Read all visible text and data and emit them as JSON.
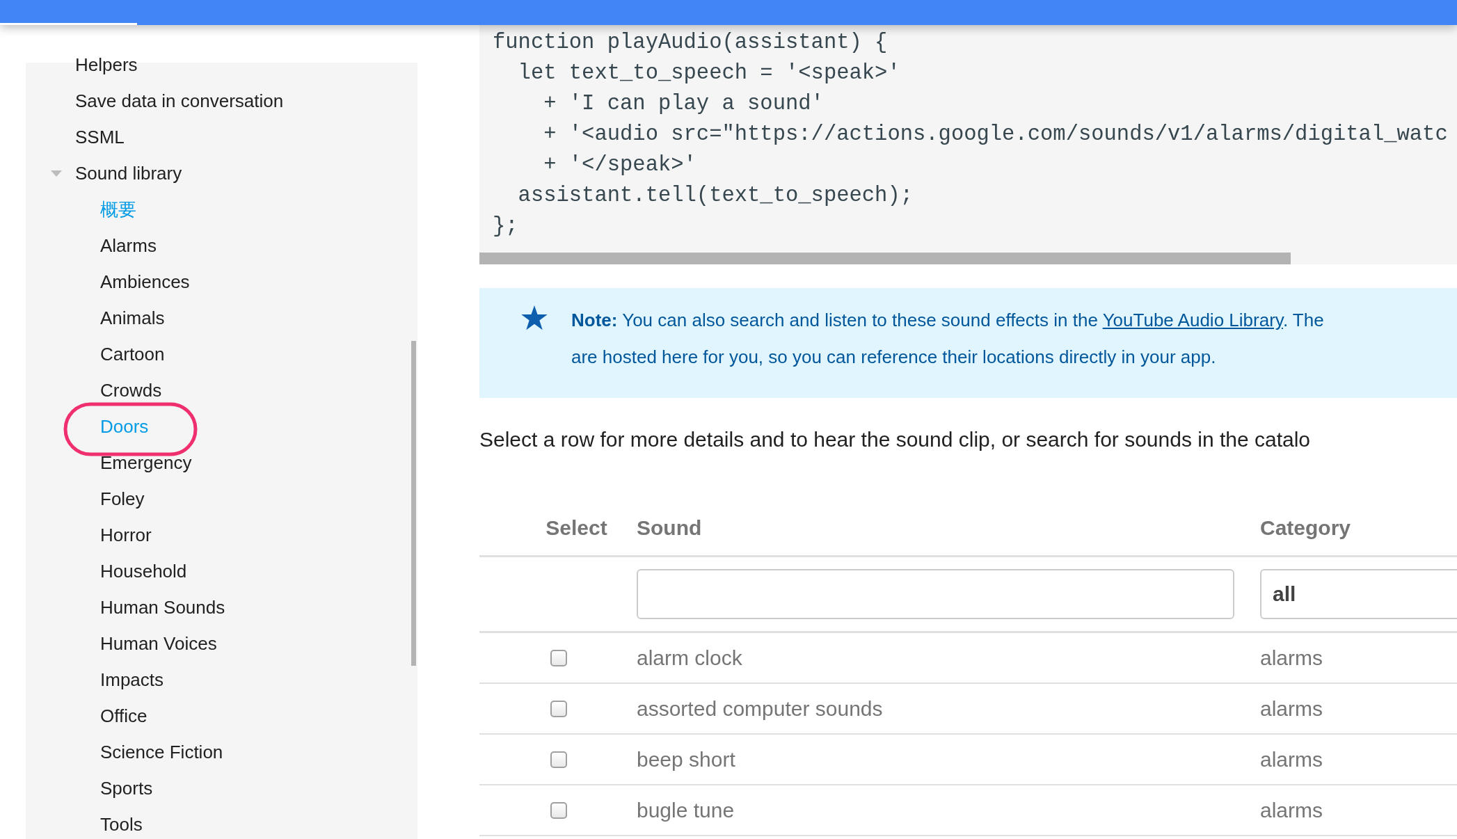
{
  "top_bar": {
    "tab_indicator": true
  },
  "sidebar": {
    "items": [
      {
        "label": "Helpers",
        "selected": false
      },
      {
        "label": "Save data in conversation",
        "selected": false
      },
      {
        "label": "SSML",
        "selected": false
      },
      {
        "label": "Sound library",
        "selected": false,
        "expanded": true,
        "children": [
          {
            "label": "概要",
            "selected": true
          },
          {
            "label": "Alarms",
            "selected": false
          },
          {
            "label": "Ambiences",
            "selected": false
          },
          {
            "label": "Animals",
            "selected": false
          },
          {
            "label": "Cartoon",
            "selected": false
          },
          {
            "label": "Crowds",
            "selected": false
          },
          {
            "label": "Doors",
            "selected": true
          },
          {
            "label": "Emergency",
            "selected": false
          },
          {
            "label": "Foley",
            "selected": false
          },
          {
            "label": "Horror",
            "selected": false
          },
          {
            "label": "Household",
            "selected": false
          },
          {
            "label": "Human Sounds",
            "selected": false
          },
          {
            "label": "Human Voices",
            "selected": false
          },
          {
            "label": "Impacts",
            "selected": false
          },
          {
            "label": "Office",
            "selected": false
          },
          {
            "label": "Science Fiction",
            "selected": false
          },
          {
            "label": "Sports",
            "selected": false
          },
          {
            "label": "Tools",
            "selected": false
          }
        ]
      }
    ]
  },
  "code": [
    "function playAudio(assistant) {",
    "  let text_to_speech = '<speak>'",
    "    + 'I can play a sound'",
    "    + '<audio src=\"https://actions.google.com/sounds/v1/alarms/digital_watc",
    "    + '</speak>'",
    "  assistant.tell(text_to_speech);",
    "};"
  ],
  "note": {
    "label": "Note:",
    "text": "You can also search and listen to these sound effects in the",
    "link": "YouTube Audio Library",
    "text_after": ". The",
    "line_2": "are hosted here for you, so you can reference their locations directly in your app."
  },
  "intro": "Select a row for more details and to hear the sound clip, or search for sounds in the catalo",
  "table": {
    "columns": [
      "Select",
      "Sound",
      "Category"
    ],
    "filters": {
      "category": "all"
    },
    "rows": [
      {
        "checked": false,
        "sound": "alarm clock",
        "category": "alarms"
      },
      {
        "checked": false,
        "sound": "assorted computer sounds",
        "category": "alarms"
      },
      {
        "checked": false,
        "sound": "beep short",
        "category": "alarms"
      },
      {
        "checked": false,
        "sound": "bugle tune",
        "category": "alarms"
      }
    ]
  }
}
